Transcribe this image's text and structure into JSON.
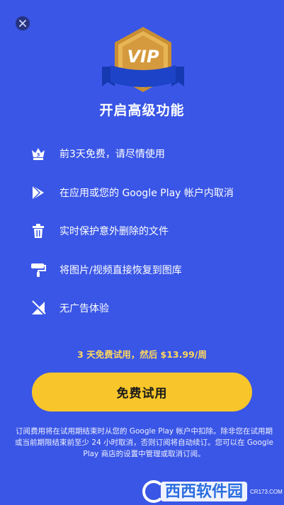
{
  "title": "开启高级功能",
  "badge_text": "VIP",
  "features": [
    {
      "icon": "crown-3-icon",
      "label": "前3天免费，请尽情使用",
      "crown_number": "3"
    },
    {
      "icon": "google-play-icon",
      "label": "在应用或您的 Google Play 帐户内取消"
    },
    {
      "icon": "trash-icon",
      "label": "实时保护意外删除的文件"
    },
    {
      "icon": "paint-roller-icon",
      "label": "将图片/视频直接恢复到图库"
    },
    {
      "icon": "no-ads-icon",
      "label": "无广告体验"
    }
  ],
  "price_text": "3 天免费试用，然后 $13.99/周",
  "cta_label": "免费试用",
  "terms": "订阅费用将在试用期结束时从您的 Google Play 帐户中扣除。除非您在试用期或当前期限结束前至少 24 小时取消，否则订阅将自动续订。您可以在 Google Play 商店的设置中管理或取消订阅。",
  "watermark": {
    "brand": "西西软件园",
    "site": "CR173.COM"
  },
  "colors": {
    "background": "#3a56e6",
    "cta": "#f8c62a",
    "price": "#ffd85c",
    "badge_gold": "#d9a441",
    "ribbon": "#1d43c8"
  }
}
